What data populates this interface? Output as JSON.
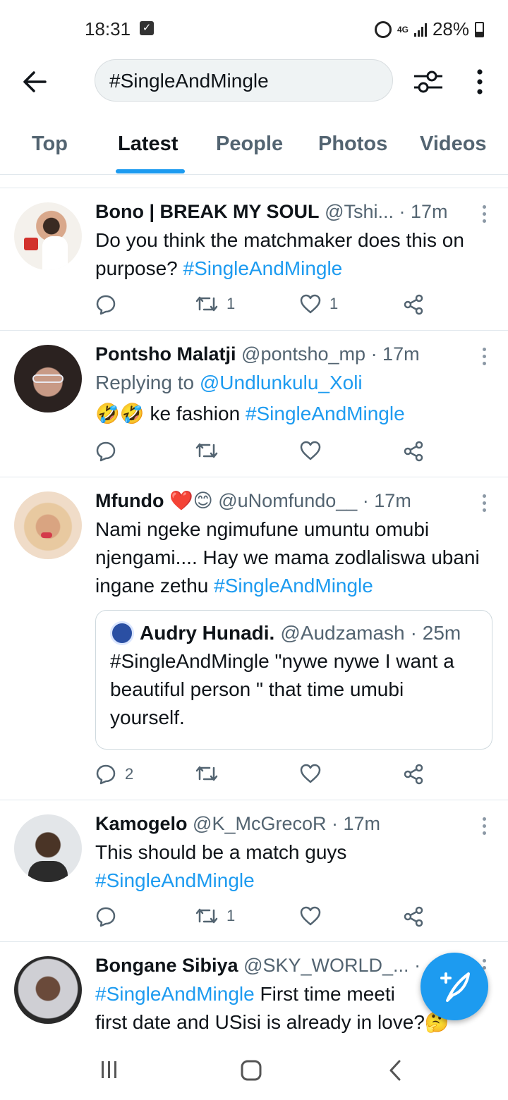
{
  "status_bar": {
    "time": "18:31",
    "network": "4G",
    "battery": "28%"
  },
  "search": {
    "value": "#SingleAndMingle"
  },
  "tabs": [
    {
      "label": "Top"
    },
    {
      "label": "Latest",
      "active": true
    },
    {
      "label": "People"
    },
    {
      "label": "Photos"
    },
    {
      "label": "Videos"
    }
  ],
  "tweets": [
    {
      "name": "Bono | BREAK MY SOUL",
      "handle": "@Tshi...",
      "time": "· 17m",
      "text": "Do you think the matchmaker does this on purpose? ",
      "hashtag": "#SingleAndMingle",
      "replies": "",
      "retweets": "1",
      "likes": "1"
    },
    {
      "name": "Pontsho Malatji",
      "handle": "@pontsho_mp",
      "time": "· 17m",
      "reply_label": "Replying to ",
      "reply_to": "@Undlunkulu_Xoli",
      "emoji": "🤣🤣",
      "text": " ke fashion ",
      "hashtag": "#SingleAndMingle",
      "replies": "",
      "retweets": "",
      "likes": ""
    },
    {
      "name": "Mfundo",
      "name_emoji": "❤️😊",
      "handle": "@uNomfundo__",
      "time": "· 17m",
      "text": "Nami ngeke ngimufune umuntu omubi njengami.... Hay we mama zodlaliswa ubani ingane zethu ",
      "hashtag": "#SingleAndMingle",
      "quote": {
        "name": "Audry Hunadi.",
        "handle": "@Audzamash",
        "time": "· 25m",
        "text": "#SingleAndMingle \"nywe nywe I want a beautiful person \" that time umubi yourself."
      },
      "replies": "2",
      "retweets": "",
      "likes": ""
    },
    {
      "name": "Kamogelo",
      "handle": "@K_McGrecoR",
      "time": "· 17m",
      "text": "This should be a match guys ",
      "hashtag": "#SingleAndMingle",
      "replies": "",
      "retweets": "1",
      "likes": ""
    },
    {
      "name": "Bongane Sibiya",
      "handle": "@SKY_WORLD_...",
      "time": "·",
      "hashtag": "#SingleAndMingle",
      "text": " First time meeti",
      "text2": "first date and USisi is already in love?",
      "emoji": "🤔"
    }
  ],
  "colors": {
    "accent": "#1d9bf0",
    "text": "#0f1419",
    "secondary": "#536471"
  },
  "icons": {
    "back": "arrow-left-icon",
    "filter": "sliders-icon",
    "more": "more-vertical-icon",
    "reply": "comment-icon",
    "retweet": "retweet-icon",
    "like": "heart-icon",
    "share": "share-icon",
    "compose": "compose-tweet-icon"
  }
}
